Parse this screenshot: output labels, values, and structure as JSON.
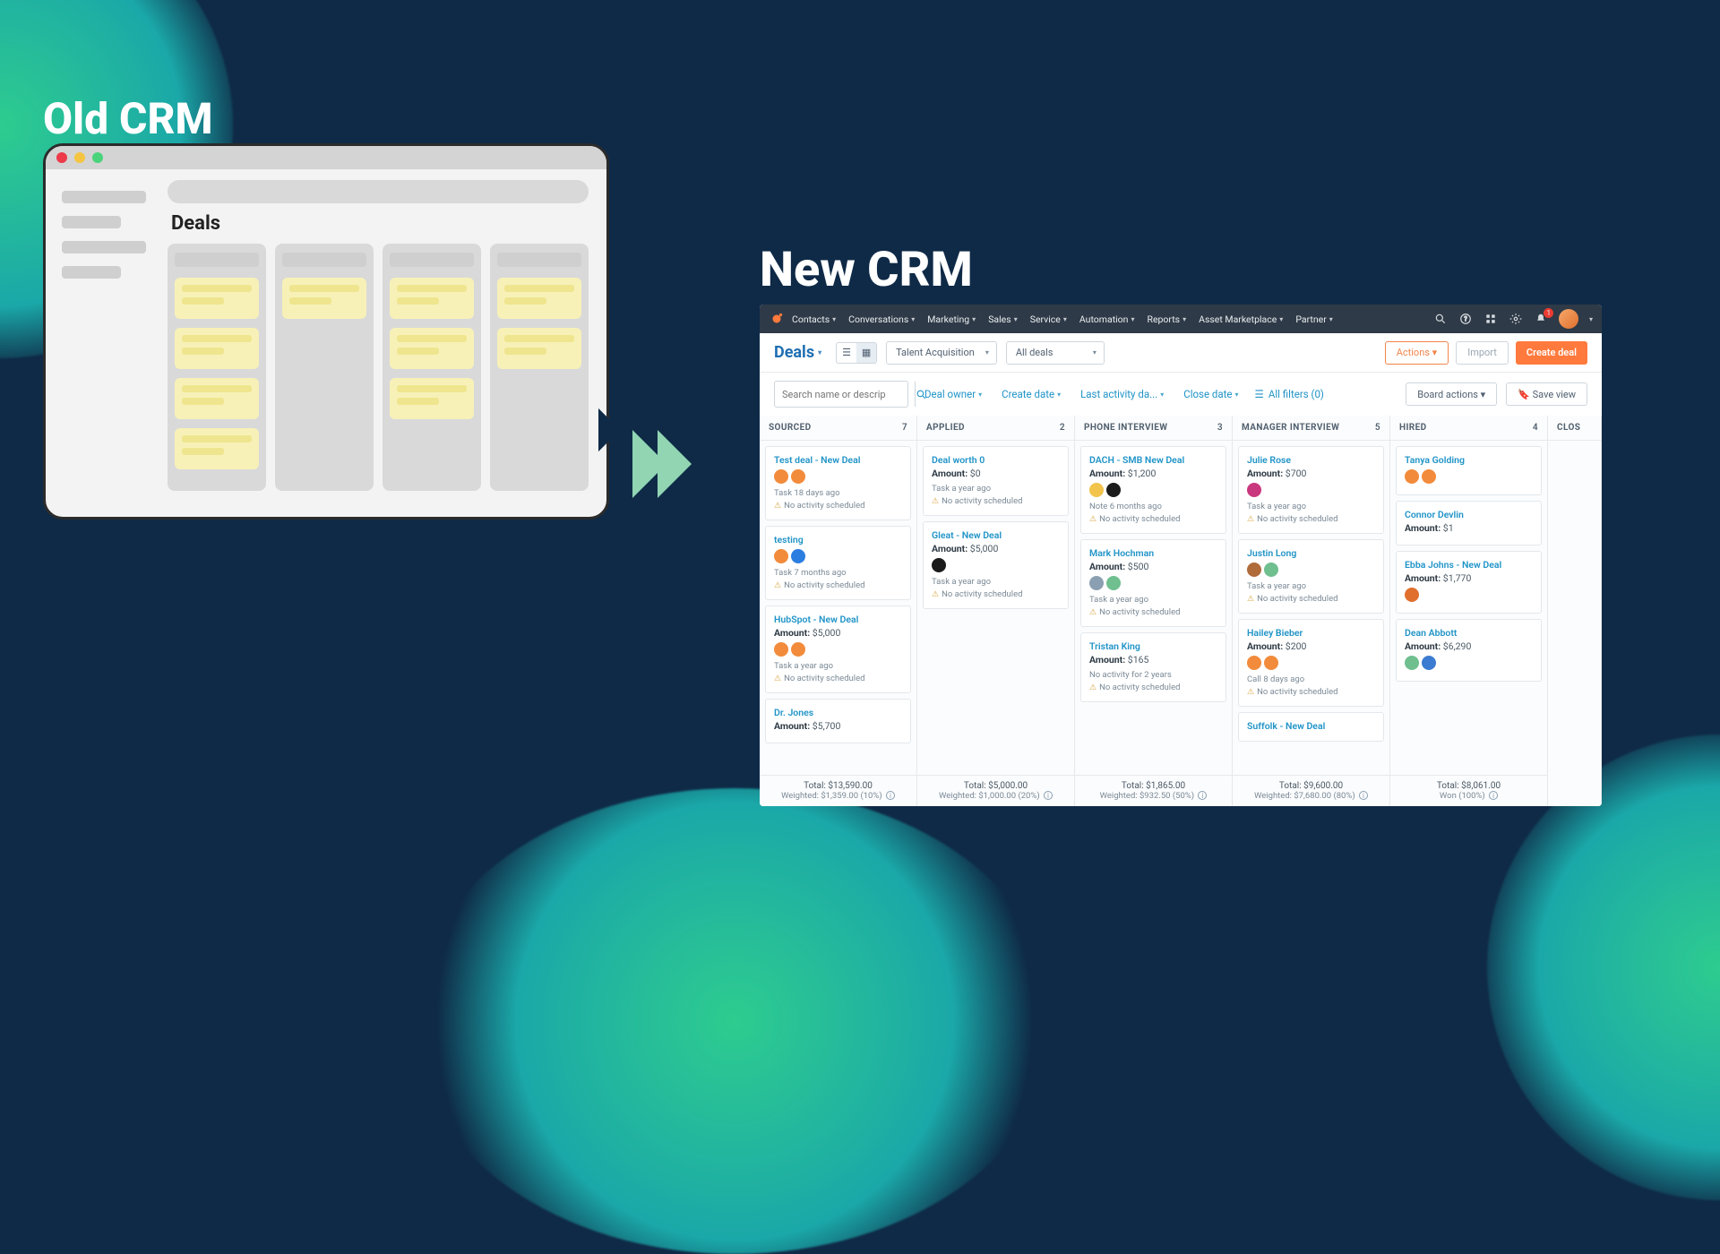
{
  "titles": {
    "old": "Old CRM",
    "new": "New CRM",
    "old_deals": "Deals"
  },
  "nav": {
    "items": [
      "Contacts",
      "Conversations",
      "Marketing",
      "Sales",
      "Service",
      "Automation",
      "Reports",
      "Asset Marketplace",
      "Partner"
    ],
    "notif_count": "1"
  },
  "subbar": {
    "deals_label": "Deals",
    "pipeline_select": "Talent Acquisition",
    "deals_select": "All deals",
    "actions": "Actions",
    "import": "Import",
    "create_deal": "Create deal"
  },
  "filterbar": {
    "search_placeholder": "Search name or descrip",
    "filters": [
      "Deal owner",
      "Create date",
      "Last activity da...",
      "Close date"
    ],
    "all_filters": "All filters (0)",
    "board_actions": "Board actions",
    "save_view": "Save view"
  },
  "board": {
    "columns": [
      {
        "name": "SOURCED",
        "count": "7",
        "cards": [
          {
            "title": "Test deal - New Deal",
            "amount": "",
            "avatars": [
              "#f28b3b",
              "#f28b3b"
            ],
            "line1": "Task 18 days ago",
            "line2": "No activity scheduled"
          },
          {
            "title": "testing",
            "amount": "",
            "avatars": [
              "#f28b3b",
              "#2b7de0"
            ],
            "line1": "Task 7 months ago",
            "line2": "No activity scheduled"
          },
          {
            "title": "HubSpot - New Deal",
            "amount": "$5,000",
            "avatars": [
              "#f28b3b",
              "#f28b3b"
            ],
            "line1": "Task a year ago",
            "line2": "No activity scheduled"
          },
          {
            "title": "Dr. Jones",
            "amount": "$5,700",
            "avatars": [],
            "line1": "",
            "line2": ""
          }
        ],
        "total": "Total: $13,590.00",
        "weighted": "Weighted: $1,359.00 (10%)"
      },
      {
        "name": "APPLIED",
        "count": "2",
        "cards": [
          {
            "title": "Deal worth 0",
            "amount": "$0",
            "avatars": [],
            "line1": "Task a year ago",
            "line2": "No activity scheduled"
          },
          {
            "title": "Gleat - New Deal",
            "amount": "$5,000",
            "avatars": [
              "#1b1b1b"
            ],
            "line1": "Task a year ago",
            "line2": "No activity scheduled"
          }
        ],
        "total": "Total: $5,000.00",
        "weighted": "Weighted: $1,000.00 (20%)"
      },
      {
        "name": "PHONE INTERVIEW",
        "count": "3",
        "cards": [
          {
            "title": "DACH - SMB New Deal",
            "amount": "$1,200",
            "avatars": [
              "#f2c44c",
              "#1b1b1b"
            ],
            "line1": "Note 6 months ago",
            "line2": "No activity scheduled"
          },
          {
            "title": "Mark Hochman",
            "amount": "$500",
            "avatars": [
              "#8aa0b2",
              "#6fbf8f"
            ],
            "line1": "Task a year ago",
            "line2": "No activity scheduled"
          },
          {
            "title": "Tristan King",
            "amount": "$165",
            "avatars": [],
            "line1": "No activity for 2 years",
            "line2": "No activity scheduled"
          }
        ],
        "total": "Total: $1,865.00",
        "weighted": "Weighted: $932.50 (50%)"
      },
      {
        "name": "MANAGER INTERVIEW",
        "count": "5",
        "cards": [
          {
            "title": "Julie Rose",
            "amount": "$700",
            "avatars": [
              "#c9377e"
            ],
            "line1": "Task a year ago",
            "line2": "No activity scheduled"
          },
          {
            "title": "Justin Long",
            "amount": "",
            "avatars": [
              "#b06b3b",
              "#6fbf8f"
            ],
            "line1": "Task a year ago",
            "line2": "No activity scheduled"
          },
          {
            "title": "Hailey Bieber",
            "amount": "$200",
            "avatars": [
              "#f28b3b",
              "#f28b3b"
            ],
            "line1": "Call 8 days ago",
            "line2": "No activity scheduled"
          },
          {
            "title": "Suffolk - New Deal",
            "amount": "",
            "avatars": [],
            "line1": "",
            "line2": ""
          }
        ],
        "total": "Total: $9,600.00",
        "weighted": "Weighted: $7,680.00 (80%)"
      },
      {
        "name": "HIRED",
        "count": "4",
        "cards": [
          {
            "title": "Tanya Golding",
            "amount": "",
            "avatars": [
              "#f28b3b",
              "#f28b3b"
            ],
            "line1": "",
            "line2": ""
          },
          {
            "title": "Connor Devlin",
            "amount": "$1",
            "avatars": [],
            "line1": "",
            "line2": ""
          },
          {
            "title": "Ebba Johns - New Deal",
            "amount": "$1,770",
            "avatars": [
              "#e06f2e"
            ],
            "line1": "",
            "line2": ""
          },
          {
            "title": "Dean Abbott",
            "amount": "$6,290",
            "avatars": [
              "#6fbf8f",
              "#3b7bd1"
            ],
            "line1": "",
            "line2": ""
          }
        ],
        "total": "Total: $8,061.00",
        "weighted": "Won (100%)"
      },
      {
        "name": "CLOS",
        "count": "",
        "cards": [],
        "total": "",
        "weighted": ""
      }
    ]
  }
}
